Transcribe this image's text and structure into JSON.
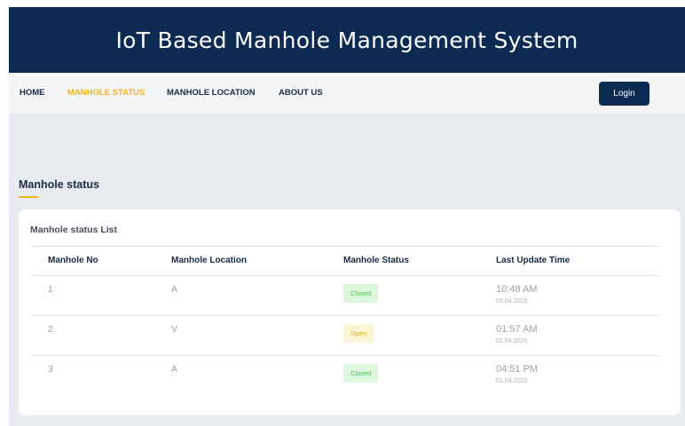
{
  "header": {
    "title": "IoT Based Manhole Management System"
  },
  "nav": {
    "items": [
      {
        "label": "HOME",
        "active": false
      },
      {
        "label": "MANHOLE STATUS",
        "active": true
      },
      {
        "label": "MANHOLE LOCATION",
        "active": false
      },
      {
        "label": "ABOUT US",
        "active": false
      }
    ],
    "login_label": "Login"
  },
  "section": {
    "heading": "Manhole status"
  },
  "card": {
    "title": "Manhole status List",
    "columns": [
      "Manhole No",
      "Manhole Location",
      "Manhole Status",
      "Last Update Time"
    ],
    "rows": [
      {
        "no": "1",
        "location": "A",
        "status": "Closed",
        "time": "10:48 AM",
        "date": "02.04.2023"
      },
      {
        "no": "2",
        "location": "V",
        "status": "Open",
        "time": "01:57 AM",
        "date": "02.04.2023"
      },
      {
        "no": "3",
        "location": "A",
        "status": "Closed",
        "time": "04:51 PM",
        "date": "01.04.2023"
      }
    ]
  },
  "colors": {
    "header_bg": "#0d2a52",
    "accent": "#f1b51c",
    "page_bg": "#e8ecf0",
    "closed_badge_bg": "#dcf7dc",
    "closed_badge_text": "#3ecb52",
    "open_badge_bg": "#fbf6d8",
    "open_badge_text": "#d7b21a"
  }
}
